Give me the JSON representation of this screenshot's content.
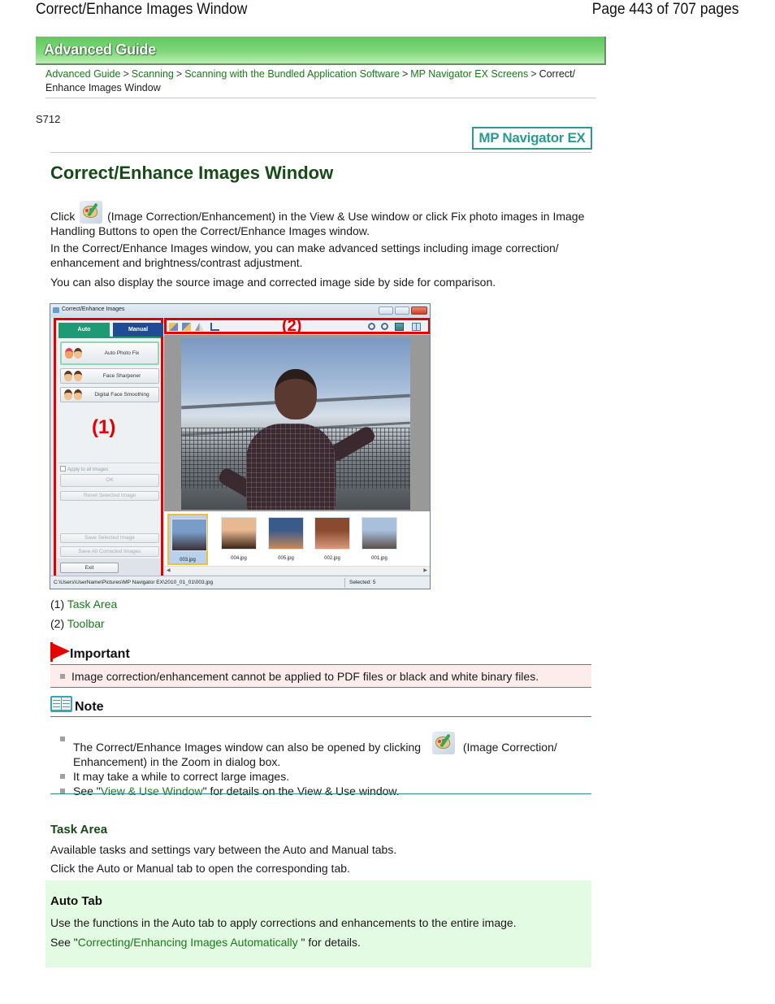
{
  "page_header": {
    "title": "Correct/Enhance Images Window",
    "page_number": "Page 443 of 707 pages"
  },
  "banner": {
    "label": "Advanced Guide"
  },
  "breadcrumb": {
    "items": [
      {
        "label": "Advanced Guide",
        "link": true
      },
      {
        "label": "Scanning",
        "link": true
      },
      {
        "label": "Scanning with the Bundled Application Software",
        "link": true
      },
      {
        "label": "MP Navigator EX Screens",
        "link": true
      },
      {
        "label": "Correct/ Enhance Images Window",
        "link": false
      }
    ],
    "separator": ">"
  },
  "doc_code": "S712",
  "product_badge": "MP Navigator EX",
  "page_title": "Correct/Enhance Images Window",
  "intro": {
    "p1_before_icon": "Click",
    "p1_icon": "image-correction-icon",
    "p1_after_icon": "(Image Correction/Enhancement) in the View & Use window or click Fix photo images in Image Handling Buttons to open the Correct/Enhance Images window.",
    "p2": "In the Correct/Enhance Images window, you can make advanced settings including image correction/ enhancement and brightness/contrast adjustment.",
    "p3": "You can also display the source image and corrected image side by side for comparison."
  },
  "app_screenshot": {
    "window_title": "Correct/Enhance Images",
    "tabs": {
      "auto": "Auto",
      "manual": "Manual"
    },
    "task_buttons": [
      "Auto Photo Fix",
      "Face Sharpener",
      "Digital Face Smoothing"
    ],
    "area_label_1": "(1)",
    "area_label_2": "(2)",
    "apply_all": "Apply to all images",
    "ok": "OK",
    "reset": "Reset Selected Image",
    "save_selected": "Save Selected Image",
    "save_all": "Save All Corrected Images",
    "exit": "Exit",
    "toolbar_icons_left": [
      "rotate-left-icon",
      "rotate-right-icon",
      "mirror-icon",
      "crop-icon"
    ],
    "toolbar_icons_right": [
      "zoom-in-icon",
      "zoom-out-icon",
      "full-screen-icon",
      "compare-icon"
    ],
    "thumbnails": [
      {
        "name": "003.jpg",
        "selected": true,
        "colors": [
          "#7a9cc8",
          "#3a3036"
        ]
      },
      {
        "name": "004.jpg",
        "selected": false,
        "colors": [
          "#e8b890",
          "#3a2418"
        ]
      },
      {
        "name": "005.jpg",
        "selected": false,
        "colors": [
          "#3a5a8a",
          "#c88a5a"
        ]
      },
      {
        "name": "002.jpg",
        "selected": false,
        "colors": [
          "#8a4a30",
          "#d89a7a"
        ]
      },
      {
        "name": "001.jpg",
        "selected": false,
        "colors": [
          "#a8c0dc",
          "#5a5048"
        ]
      }
    ],
    "status_path": "C:\\Users\\UserName\\Pictures\\MP Navigator EX\\2010_01_01\\003.jpg",
    "status_selected": "Selected: 5"
  },
  "callouts": [
    {
      "num": "(1)",
      "label": "Task Area"
    },
    {
      "num": "(2)",
      "label": "Toolbar"
    }
  ],
  "important": {
    "label": "Important",
    "items": [
      "Image correction/enhancement cannot be applied to PDF files or black and white binary files."
    ]
  },
  "note": {
    "label": "Note",
    "item1_before_icon": "The Correct/Enhance Images window can also be opened by clicking",
    "item1_after_icon": "(Image Correction/ Enhancement) in the Zoom in dialog box.",
    "item2": "It may take a while to correct large images.",
    "item3_before": "See \"",
    "item3_link": "View & Use Window",
    "item3_after": "\" for details on the View & Use window."
  },
  "task_area": {
    "title": "Task Area",
    "p1": "Available tasks and settings vary between the Auto and Manual tabs.",
    "p2": "Click the Auto or Manual tab to open the corresponding tab."
  },
  "auto_tab": {
    "title": "Auto Tab",
    "p1": "Use the functions in the Auto tab to apply corrections and enhancements to the entire image.",
    "p2_before": "See \"",
    "p2_link": "Correcting/Enhancing Images Automatically",
    "p2_after": " \" for details."
  }
}
